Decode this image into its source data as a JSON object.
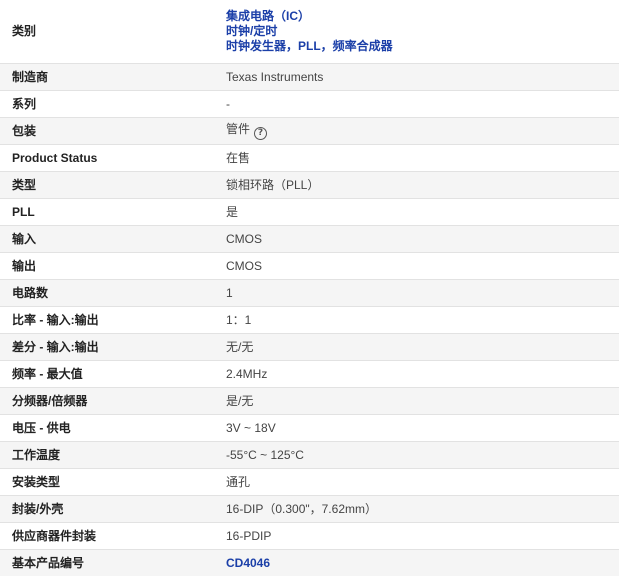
{
  "category": {
    "label": "类别",
    "links": [
      "集成电路（IC）",
      "时钟/定时",
      "时钟发生器，PLL，频率合成器"
    ]
  },
  "rows": [
    {
      "label": "制造商",
      "value": "Texas Instruments"
    },
    {
      "label": "系列",
      "value": "-"
    },
    {
      "label": "包装",
      "value": "管件",
      "help_icon": "?"
    },
    {
      "label": "Product Status",
      "value": "在售"
    },
    {
      "label": "类型",
      "value": "锁相环路（PLL）"
    },
    {
      "label": "PLL",
      "value": "是"
    },
    {
      "label": "输入",
      "value": "CMOS"
    },
    {
      "label": "输出",
      "value": "CMOS"
    },
    {
      "label": "电路数",
      "value": "1"
    },
    {
      "label": "比率 - 输入:输出",
      "value": "1：1"
    },
    {
      "label": "差分 - 输入:输出",
      "value": "无/无"
    },
    {
      "label": "频率 - 最大值",
      "value": "2.4MHz"
    },
    {
      "label": "分频器/倍频器",
      "value": "是/无"
    },
    {
      "label": "电压 - 供电",
      "value": "3V ~ 18V"
    },
    {
      "label": "工作温度",
      "value": "-55°C ~ 125°C"
    },
    {
      "label": "安装类型",
      "value": "通孔"
    },
    {
      "label": "封装/外壳",
      "value": "16-DIP（0.300\"，7.62mm）"
    },
    {
      "label": "供应商器件封装",
      "value": "16-PDIP"
    }
  ],
  "base_product": {
    "label": "基本产品编号",
    "value": "CD4046"
  },
  "colors": {
    "link": "#1b3fa8",
    "row_alt": "#f5f5f5",
    "border": "#e2e2e2"
  }
}
